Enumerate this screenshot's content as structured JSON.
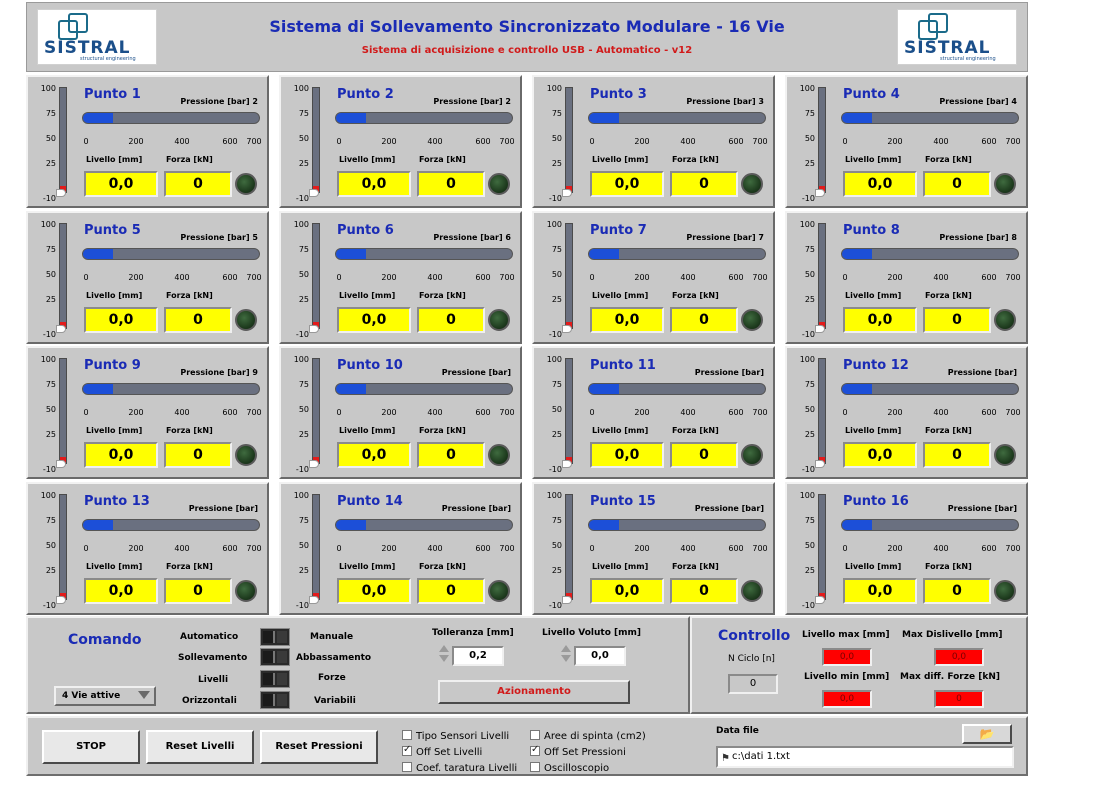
{
  "header": {
    "title": "Sistema di Sollevamento Sincronizzato Modulare - 16 Vie",
    "subtitle": "Sistema di acquisizione e controllo USB - Automatico - v12",
    "logo_text": "SISTRAL",
    "logo_sub": "structural engineering"
  },
  "level_ticks": [
    "100",
    "75",
    "50",
    "25",
    "-10"
  ],
  "pressure_ticks": [
    "0",
    "200",
    "400",
    "600",
    "700"
  ],
  "level_label": "Livello [mm]",
  "force_label": "Forza [kN]",
  "points": [
    {
      "name": "Punto 1",
      "pressure_label": "Pressione [bar] 2",
      "level": "0,0",
      "force": "0",
      "pressure_fill": 0.17,
      "level_fill": 0.06
    },
    {
      "name": "Punto 2",
      "pressure_label": "Pressione [bar] 2",
      "level": "0,0",
      "force": "0",
      "pressure_fill": 0.17,
      "level_fill": 0.06
    },
    {
      "name": "Punto 3",
      "pressure_label": "Pressione [bar] 3",
      "level": "0,0",
      "force": "0",
      "pressure_fill": 0.17,
      "level_fill": 0.06
    },
    {
      "name": "Punto 4",
      "pressure_label": "Pressione [bar] 4",
      "level": "0,0",
      "force": "0",
      "pressure_fill": 0.17,
      "level_fill": 0.06
    },
    {
      "name": "Punto 5",
      "pressure_label": "Pressione [bar] 5",
      "level": "0,0",
      "force": "0",
      "pressure_fill": 0.17,
      "level_fill": 0.06
    },
    {
      "name": "Punto 6",
      "pressure_label": "Pressione [bar] 6",
      "level": "0,0",
      "force": "0",
      "pressure_fill": 0.17,
      "level_fill": 0.06
    },
    {
      "name": "Punto 7",
      "pressure_label": "Pressione [bar] 7",
      "level": "0,0",
      "force": "0",
      "pressure_fill": 0.17,
      "level_fill": 0.06
    },
    {
      "name": "Punto 8",
      "pressure_label": "Pressione [bar] 8",
      "level": "0,0",
      "force": "0",
      "pressure_fill": 0.17,
      "level_fill": 0.06
    },
    {
      "name": "Punto 9",
      "pressure_label": "Pressione [bar] 9",
      "level": "0,0",
      "force": "0",
      "pressure_fill": 0.17,
      "level_fill": 0.06
    },
    {
      "name": "Punto 10",
      "pressure_label": "Pressione [bar]",
      "level": "0,0",
      "force": "0",
      "pressure_fill": 0.17,
      "level_fill": 0.06
    },
    {
      "name": "Punto 11",
      "pressure_label": "Pressione [bar]",
      "level": "0,0",
      "force": "0",
      "pressure_fill": 0.17,
      "level_fill": 0.06
    },
    {
      "name": "Punto 12",
      "pressure_label": "Pressione [bar]",
      "level": "0,0",
      "force": "0",
      "pressure_fill": 0.17,
      "level_fill": 0.06
    },
    {
      "name": "Punto 13",
      "pressure_label": "Pressione [bar]",
      "level": "0,0",
      "force": "0",
      "pressure_fill": 0.17,
      "level_fill": 0.06
    },
    {
      "name": "Punto 14",
      "pressure_label": "Pressione [bar]",
      "level": "0,0",
      "force": "0",
      "pressure_fill": 0.17,
      "level_fill": 0.06
    },
    {
      "name": "Punto 15",
      "pressure_label": "Pressione [bar]",
      "level": "0,0",
      "force": "0",
      "pressure_fill": 0.17,
      "level_fill": 0.06
    },
    {
      "name": "Punto 16",
      "pressure_label": "Pressione [bar]",
      "level": "0,0",
      "force": "0",
      "pressure_fill": 0.17,
      "level_fill": 0.06
    }
  ],
  "command": {
    "title": "Comando",
    "switches": [
      {
        "left": "Automatico",
        "right": "Manuale"
      },
      {
        "left": "Sollevamento",
        "right": "Abbassamento"
      },
      {
        "left": "Livelli",
        "right": "Forze"
      },
      {
        "left": "Orizzontali",
        "right": "Variabili"
      }
    ],
    "ways_select": "4 Vie attive",
    "tolerance_label": "Tolleranza [mm]",
    "tolerance_value": "0,2",
    "target_level_label": "Livello Voluto [mm]",
    "target_level_value": "0,0",
    "actuate_button": "Azionamento"
  },
  "control": {
    "title": "Controllo",
    "cycle_label": "N Ciclo [n]",
    "cycle_value": "0",
    "level_max_label": "Livello max [mm]",
    "level_max_value": "0,0",
    "level_min_label": "Livello min [mm]",
    "level_min_value": "0,0",
    "max_diff_level_label": "Max Dislivello [mm]",
    "max_diff_level_value": "0,0",
    "max_diff_force_label": "Max diff. Forze [kN]",
    "max_diff_force_value": "0",
    "alarm_color": "#ff0000"
  },
  "bottom": {
    "stop_button": "STOP",
    "reset_levels_button": "Reset Livelli",
    "reset_pressures_button": "Reset Pressioni",
    "checkboxes": [
      {
        "label": "Tipo Sensori Livelli",
        "checked": false
      },
      {
        "label": "Off Set Livelli",
        "checked": true
      },
      {
        "label": "Coef. taratura Livelli",
        "checked": false
      },
      {
        "label": "Aree di spinta (cm2)",
        "checked": false
      },
      {
        "label": "Off Set Pressioni",
        "checked": true
      },
      {
        "label": "Oscilloscopio",
        "checked": false
      }
    ],
    "data_file_label": "Data file",
    "data_file_path": "c:\\dati 1.txt",
    "folder_icon": "folder-icon"
  },
  "colors": {
    "title_blue": "#1a2bb5",
    "subtitle_red": "#d11a1a",
    "display_yellow": "#ffff00",
    "pressure_fill": "#1c4fd8",
    "level_fill": "#e31b1b",
    "panel_gray": "#c8c8c8"
  }
}
